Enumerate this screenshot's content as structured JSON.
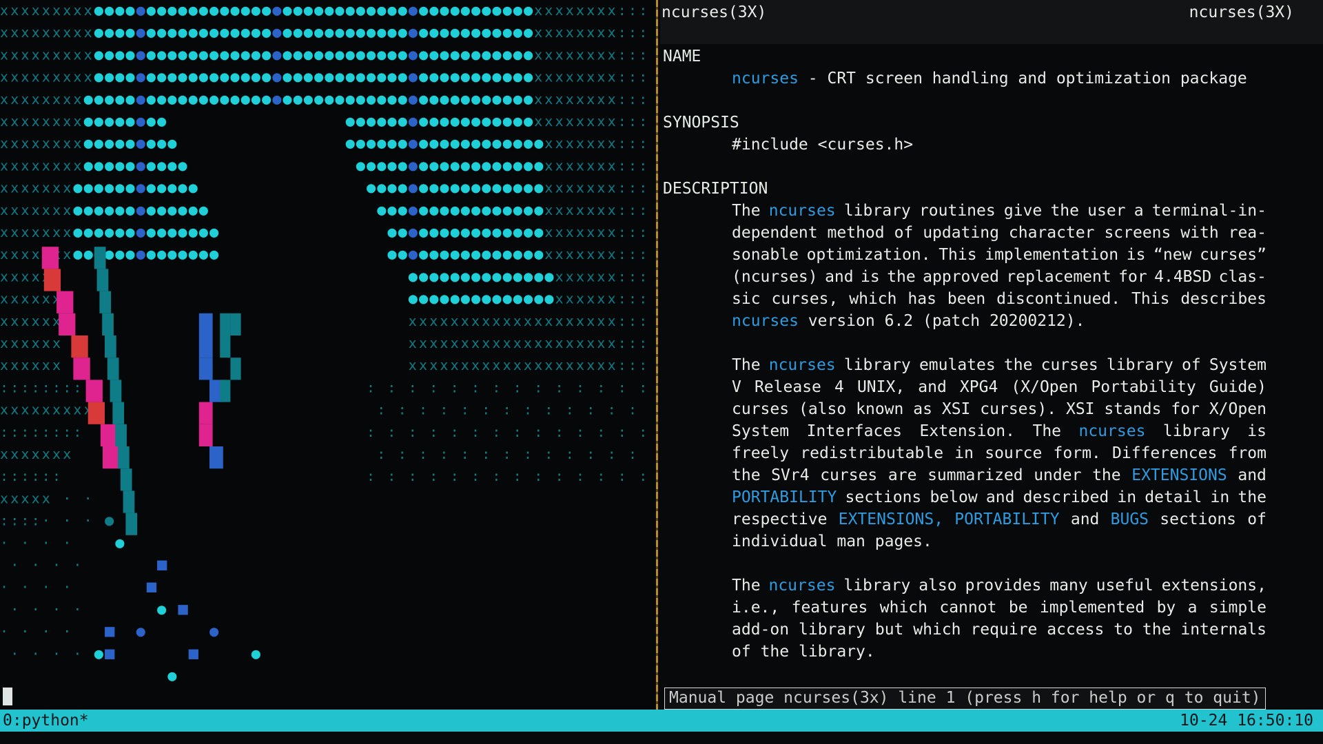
{
  "left_pane": {
    "art_glyphs": [
      "●",
      "x",
      ":",
      "·",
      "■"
    ],
    "colors": {
      "cyan": "#1fd0d8",
      "teal_dim": "#0f7d88",
      "blue": "#2b63c9",
      "magenta": "#e0248f",
      "red": "#d83a3a",
      "green": "#2bbf6a"
    }
  },
  "man": {
    "header_left": "ncurses(3X)",
    "header_right": "ncurses(3X)",
    "sections": {
      "name": "NAME",
      "synopsis": "SYNOPSIS",
      "description": "DESCRIPTION"
    },
    "name_cmd": "ncurses",
    "name_desc": "- CRT screen handling and optimization package",
    "include": "#include <curses.h>",
    "lines": [
      [
        "The",
        "ncurses",
        "library",
        "routines",
        "give",
        "the",
        "user",
        "a",
        "terminal-in-"
      ],
      [
        "dependent",
        "method",
        "of",
        "updating",
        "character",
        "screens",
        "with",
        "rea-"
      ],
      [
        "sonable",
        "optimization.",
        "This",
        "implementation",
        "is",
        "“new",
        "curses”"
      ],
      [
        "(ncurses)",
        "and",
        "is",
        "the",
        "approved",
        "replacement",
        "for",
        "4.4BSD",
        "clas-"
      ],
      [
        "sic",
        "curses,",
        "which",
        "has",
        "been",
        "discontinued.",
        "This",
        "describes"
      ],
      [
        "ncurses",
        "version",
        "6.2",
        "(patch",
        "20200212)."
      ],
      [
        "The",
        "ncurses",
        "library",
        "emulates",
        "the",
        "curses",
        "library",
        "of",
        "System"
      ],
      [
        "V",
        "Release",
        "4",
        "UNIX,",
        "and",
        "XPG4",
        "(X/Open",
        "Portability",
        "Guide)"
      ],
      [
        "curses",
        "(also",
        "known",
        "as",
        "XSI",
        "curses).",
        "XSI",
        "stands",
        "for",
        "X/Open"
      ],
      [
        "System",
        "Interfaces",
        "Extension.",
        "The",
        "ncurses",
        "library",
        "is"
      ],
      [
        "freely",
        "redistributable",
        "in",
        "source",
        "form.",
        "Differences",
        "from"
      ],
      [
        "the",
        "SVr4",
        "curses",
        "are",
        "summarized",
        "under",
        "the",
        "EXTENSIONS",
        "and"
      ],
      [
        "PORTABILITY",
        "sections",
        "below",
        "and",
        "described",
        "in",
        "detail",
        "in",
        "the"
      ],
      [
        "respective",
        "EXTENSIONS,",
        "PORTABILITY",
        "and",
        "BUGS",
        "sections",
        "of"
      ],
      [
        "individual",
        "man",
        "pages."
      ],
      [
        "The",
        "ncurses",
        "library",
        "also",
        "provides",
        "many",
        "useful",
        "extensions,"
      ],
      [
        "i.e.,",
        "features",
        "which",
        "cannot",
        "be",
        "implemented",
        "by",
        "a",
        "simple"
      ],
      [
        "add-on",
        "library",
        "but",
        "which",
        "require",
        "access",
        "to",
        "the",
        "internals"
      ],
      [
        "of",
        "the",
        "library."
      ]
    ],
    "status": "Manual page ncurses(3x) line 1 (press h for help or q to quit)"
  },
  "tmux": {
    "window": "0:python*",
    "clock": "10-24 16:50:10",
    "bar_color": "#22c3cf"
  }
}
